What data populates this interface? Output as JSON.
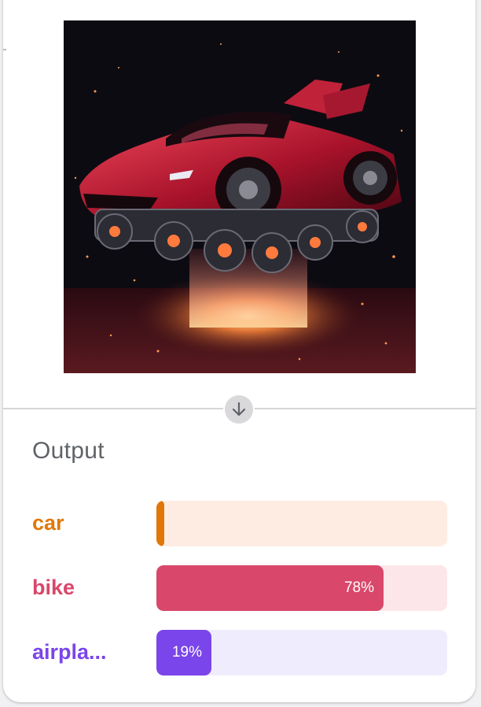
{
  "input_image": {
    "icon": "futuristic-flying-car-image",
    "description_colors": {
      "car_body": "#b8162e",
      "glow": "#ff7a3d",
      "background": "#0d0b12"
    }
  },
  "divider": {
    "icon": "arrow-down-icon"
  },
  "output": {
    "title": "Output",
    "predictions": [
      {
        "label": "car",
        "score": 0.02,
        "score_text": "",
        "color": "#e07708",
        "track_color": "#feece2"
      },
      {
        "label": "bike",
        "score": 0.78,
        "score_text": "78%",
        "color": "#d9476a",
        "track_color": "#fde6ea"
      },
      {
        "label": "airpla...",
        "score": 0.19,
        "score_text": "19%",
        "color": "#7a45ea",
        "track_color": "#efedfd"
      }
    ]
  }
}
